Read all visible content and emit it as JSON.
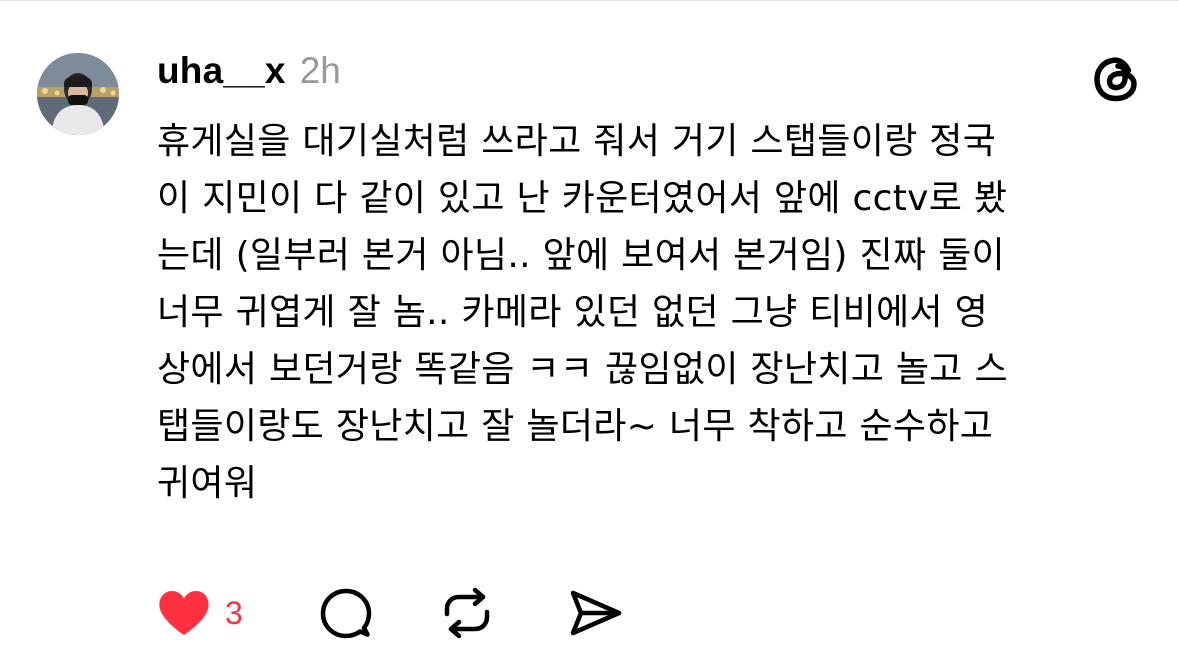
{
  "post": {
    "username": "uha__x",
    "timestamp": "2h",
    "body_lines": [
      "휴게실을 대기실처럼 쓰라고 줘서 거기 스탭들이랑 정국",
      "이 지민이 다 같이 있고 난 카운터였어서 앞에 cctv로 봤",
      "는데 (일부러 본거 아님.. 앞에 보여서 본거임) 진짜 둘이",
      "너무 귀엽게 잘 놈.. 카메라 있던 없던 그냥 티비에서 영",
      "상에서 보던거랑 똑같음 ㅋㅋ 끊임없이 장난치고 놀고 스",
      "탭들이랑도 장난치고 잘 놀더라~ 너무 착하고 순수하고",
      "귀여워"
    ]
  },
  "actions": {
    "like": {
      "icon": "heart-filled-icon",
      "count": "3",
      "liked": true
    },
    "reply": {
      "icon": "speech-bubble-icon"
    },
    "repost": {
      "icon": "repost-icon"
    },
    "share": {
      "icon": "paper-plane-icon"
    }
  },
  "brand": {
    "icon": "threads-logo-icon"
  },
  "colors": {
    "text": "#000000",
    "muted": "#999999",
    "like": "#ff3040",
    "icon": "#000000",
    "divider": "#e6e6e6"
  }
}
